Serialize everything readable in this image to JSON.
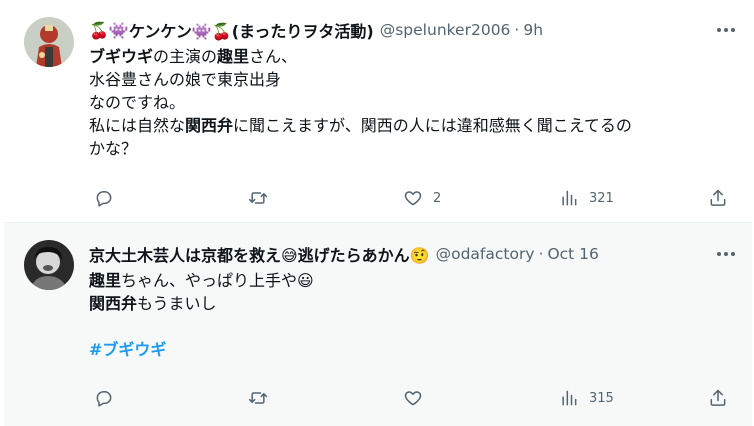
{
  "tweets": [
    {
      "name_prefix": "🍒👾",
      "name_main": "ケンケン",
      "name_suffix": "👾🍒(まったりヲタ活動)",
      "handle": "@spelunker2006",
      "separator": "·",
      "time": "9h",
      "lines": [
        {
          "segments": [
            {
              "text": "ブギウギ",
              "bold": true
            },
            {
              "text": "の主演の"
            },
            {
              "text": "趣里",
              "bold": true
            },
            {
              "text": "さん、"
            }
          ]
        },
        {
          "segments": [
            {
              "text": "水谷豊さんの娘で東京出身"
            }
          ]
        },
        {
          "segments": [
            {
              "text": "なのですね。"
            }
          ]
        },
        {
          "segments": [
            {
              "text": "私には自然な"
            },
            {
              "text": "関西弁",
              "bold": true
            },
            {
              "text": "に聞こえますが、関西の人には違和感無く聞こえてるの"
            }
          ]
        },
        {
          "segments": [
            {
              "text": "かな？"
            }
          ]
        }
      ],
      "replies": "",
      "retweets": "",
      "likes": "2",
      "views": "321",
      "avatar_colors": {
        "bg": "#c9cfc5",
        "figure": "#b23a2a",
        "accent": "#e8d9a0"
      }
    },
    {
      "name_prefix": "",
      "name_main": "京大土木芸人は京都を救え😅逃げたらあかん🤨",
      "name_suffix": "",
      "handle": "@odafactory",
      "separator": "·",
      "time": "Oct 16",
      "lines": [
        {
          "segments": [
            {
              "text": "趣里",
              "bold": true
            },
            {
              "text": "ちゃん、やっぱり上手や😃"
            }
          ]
        },
        {
          "segments": [
            {
              "text": "関西弁",
              "bold": true
            },
            {
              "text": "もうまいし"
            }
          ]
        },
        {
          "segments": [
            {
              "text": ""
            }
          ]
        },
        {
          "segments": [
            {
              "text": "#ブギウギ",
              "hashtag": true
            }
          ]
        }
      ],
      "replies": "",
      "retweets": "",
      "likes": "",
      "views": "315",
      "avatar_colors": {
        "bg": "#2a2a2a",
        "figure": "#d8d8d8",
        "accent": "#777777"
      }
    }
  ],
  "icons": [
    "reply-icon",
    "retweet-icon",
    "like-icon",
    "views-icon",
    "share-icon",
    "more-icon"
  ],
  "colors": {
    "text": "#0f1419",
    "secondary": "#536471",
    "link": "#1d9bf0",
    "hover_bg": "#f7f9f9"
  }
}
